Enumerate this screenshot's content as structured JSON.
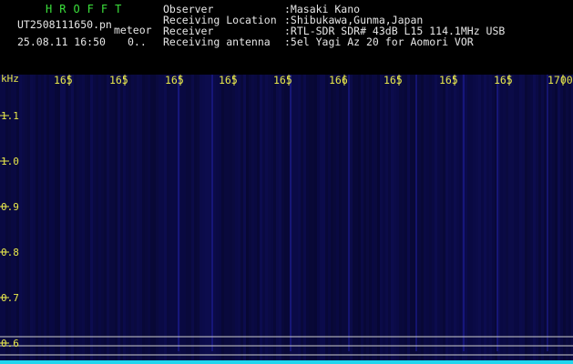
{
  "header": {
    "title": "HROFFT",
    "filename": "UT2508111650.pn",
    "file_type": "meteor",
    "timestamp": "25.08.11 16:50",
    "count": "0..",
    "info_labels": [
      "Observer",
      "Receiving Location",
      "Receiver",
      "Receiving antenna"
    ],
    "info_values": [
      ":Masaki Kano",
      ":Shibukawa,Gunma,Japan",
      ":RTL-SDR SDR# 43dB L15 114.1MHz USB",
      ":5el Yagi Az 20 for Aomori VOR"
    ]
  },
  "spectrogram": {
    "unit_label": "kHz",
    "y_tick_labels": [
      "1.1",
      "1.0",
      "0.9",
      "0.8",
      "0.7",
      "0.6"
    ],
    "x_tick_labels": [
      "165",
      "165",
      "165",
      "165",
      "165",
      "166",
      "165",
      "165",
      "165",
      "1700"
    ],
    "colors": {
      "background": "#07072f",
      "noise": "#1a1aa6",
      "tick_label": "#e8e84a",
      "guide_line": "#cfcfcf",
      "baseline_signal": "#22d5ee"
    }
  }
}
